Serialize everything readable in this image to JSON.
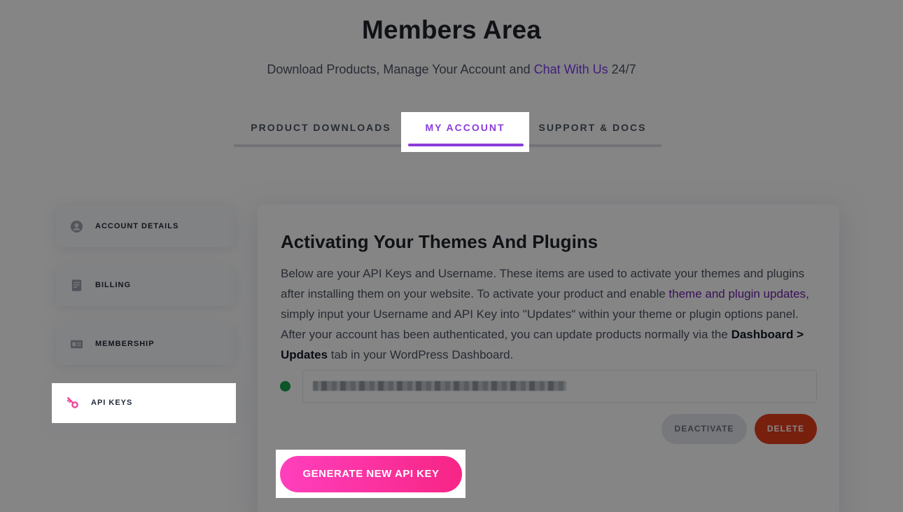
{
  "header": {
    "title": "Members Area",
    "subtitle_prefix": "Download Products, Manage Your Account and ",
    "subtitle_link": "Chat With Us",
    "subtitle_suffix": " 24/7"
  },
  "tabs": [
    {
      "label": "PRODUCT DOWNLOADS",
      "active": false
    },
    {
      "label": "MY ACCOUNT",
      "active": true
    },
    {
      "label": "SUPPORT & DOCS",
      "active": false
    }
  ],
  "sidebar": {
    "items": [
      {
        "label": "ACCOUNT DETAILS",
        "icon": "user-circle-icon"
      },
      {
        "label": "BILLING",
        "icon": "invoice-icon"
      },
      {
        "label": "MEMBERSHIP",
        "icon": "id-card-icon"
      },
      {
        "label": "API KEYS",
        "icon": "key-icon",
        "active": true
      }
    ]
  },
  "main": {
    "title": "Activating Your Themes And Plugins",
    "desc_part1": "Below are your API Keys and Username. These items are used to activate your themes and plugins after installing them on your website. To activate your product and enable ",
    "desc_link": "theme and plugin updates",
    "desc_part2": ", simply input your Username and API Key into \"Updates\" within your theme or plugin options panel. After your account has been authenticated, you can update products normally via the ",
    "desc_strong": "Dashboard > Updates",
    "desc_part3": " tab in your WordPress Dashboard.",
    "key_status_color": "#16a34a",
    "deactivate_label": "DEACTIVATE",
    "delete_label": "DELETE",
    "generate_label": "GENERATE NEW API KEY"
  },
  "colors": {
    "accent": "#8b3ddb",
    "delete": "#e53e1c",
    "generate": "#f72585"
  }
}
